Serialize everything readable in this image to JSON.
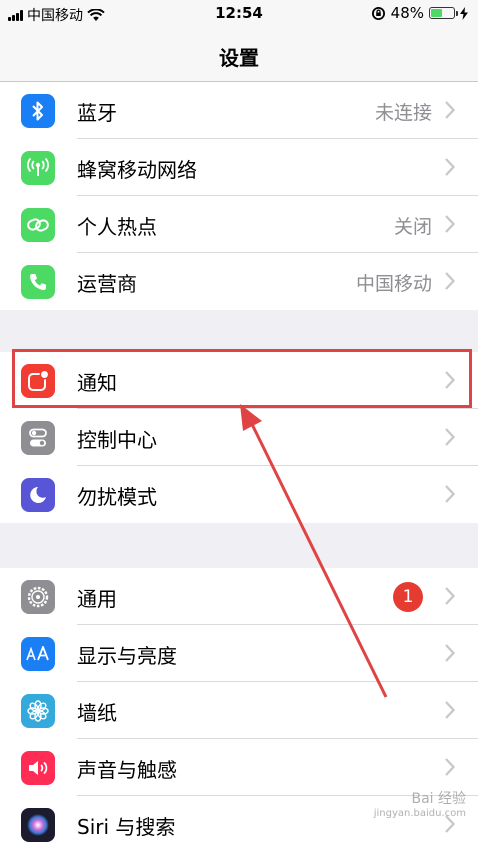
{
  "status_bar": {
    "carrier": "中国移动",
    "time": "12:54",
    "battery_percent": "48%",
    "battery_level": 0.48
  },
  "header": {
    "title": "设置"
  },
  "groups": [
    [
      {
        "label": "蓝牙",
        "value": "未连接",
        "icon": "bluetooth-icon",
        "color": "#1a7ef5"
      },
      {
        "label": "蜂窝移动网络",
        "value": "",
        "icon": "antenna-icon",
        "color": "#4cd964"
      },
      {
        "label": "个人热点",
        "value": "关闭",
        "icon": "hotspot-icon",
        "color": "#4cd964"
      },
      {
        "label": "运营商",
        "value": "中国移动",
        "icon": "phone-icon",
        "color": "#4cd964"
      }
    ],
    [
      {
        "label": "通知",
        "value": "",
        "icon": "notifications-icon",
        "color": "#f23c32"
      },
      {
        "label": "控制中心",
        "value": "",
        "icon": "toggles-icon",
        "color": "#8e8e93"
      },
      {
        "label": "勿扰模式",
        "value": "",
        "icon": "moon-icon",
        "color": "#5856d6"
      }
    ],
    [
      {
        "label": "通用",
        "value": "",
        "badge": "1",
        "icon": "gear-icon",
        "color": "#8e8e93"
      },
      {
        "label": "显示与亮度",
        "value": "",
        "icon": "display-aa-icon",
        "color": "#1a7ef5"
      },
      {
        "label": "墙纸",
        "value": "",
        "icon": "flower-icon",
        "color": "#34aadc"
      },
      {
        "label": "声音与触感",
        "value": "",
        "icon": "speaker-icon",
        "color": "#ff2d55"
      },
      {
        "label": "Siri 与搜索",
        "value": "",
        "icon": "siri-icon",
        "color": "#1c1c2e"
      }
    ]
  ],
  "watermark": {
    "text": "Bai 经验",
    "sub": "jingyan.baidu.com"
  },
  "highlight_color": "#e04343"
}
